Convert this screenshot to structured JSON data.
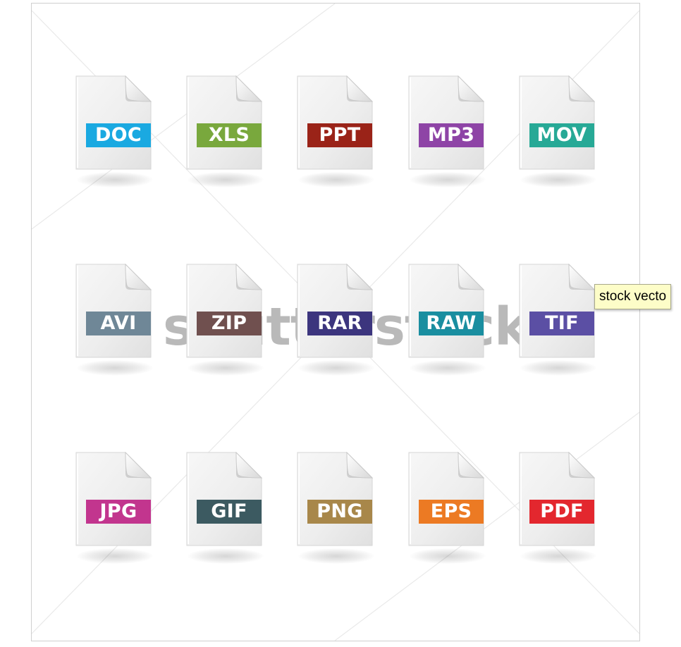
{
  "tooltip": {
    "text": "stock vecto"
  },
  "watermark": {
    "text": "shutterstock"
  },
  "file_icons": [
    {
      "label": "DOC",
      "color": "#1aa9e1"
    },
    {
      "label": "XLS",
      "color": "#79a83d"
    },
    {
      "label": "PPT",
      "color": "#9a2318"
    },
    {
      "label": "MP3",
      "color": "#8e44a6"
    },
    {
      "label": "MOV",
      "color": "#27a996"
    },
    {
      "label": "AVI",
      "color": "#6f8797"
    },
    {
      "label": "ZIP",
      "color": "#70504f"
    },
    {
      "label": "RAR",
      "color": "#3c357e"
    },
    {
      "label": "RAW",
      "color": "#1a8ea0"
    },
    {
      "label": "TIF",
      "color": "#5b4fa4"
    },
    {
      "label": "JPG",
      "color": "#c2358e"
    },
    {
      "label": "GIF",
      "color": "#3c5a61"
    },
    {
      "label": "PNG",
      "color": "#a8874a"
    },
    {
      "label": "EPS",
      "color": "#ec7a23"
    },
    {
      "label": "PDF",
      "color": "#e3272e"
    }
  ]
}
